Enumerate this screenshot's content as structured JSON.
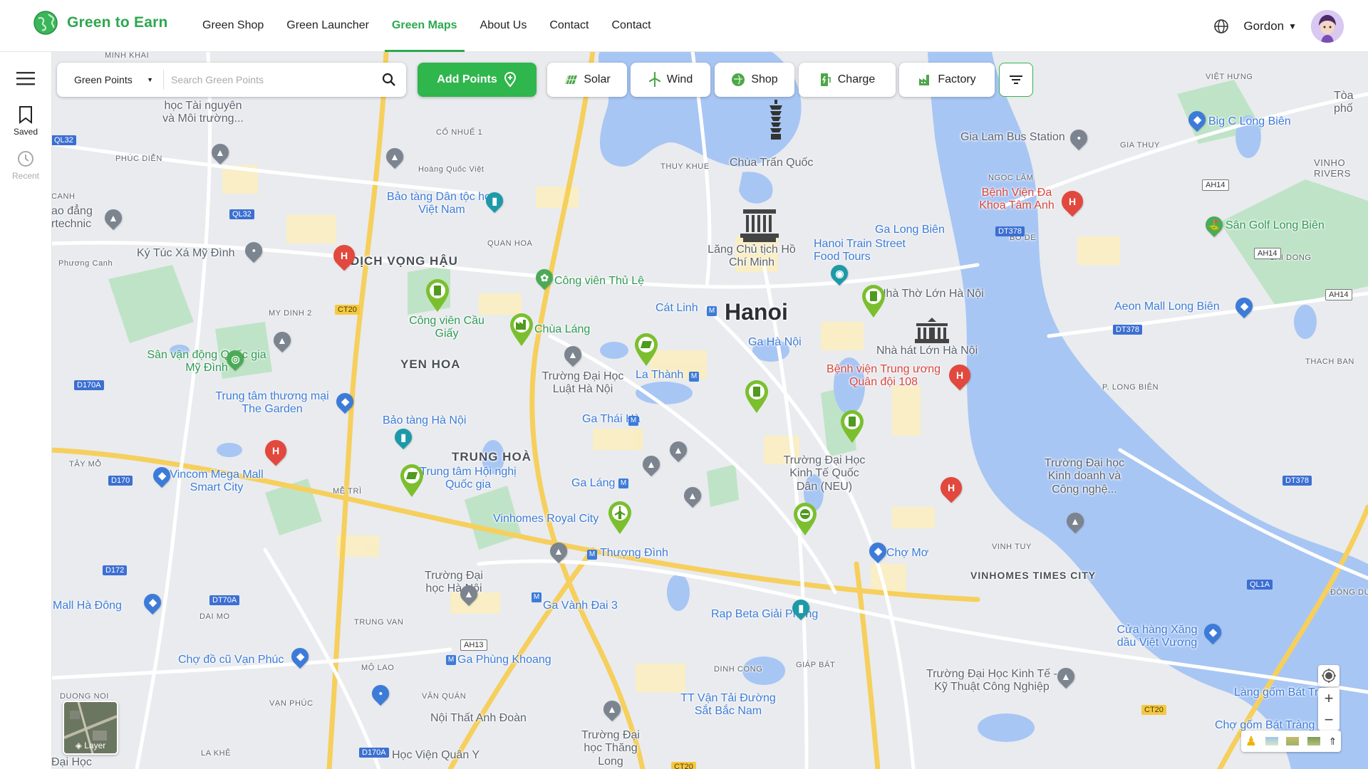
{
  "brand": {
    "name": "Green to Earn",
    "color": "#2da84f"
  },
  "nav": [
    {
      "label": "Green Shop",
      "active": false
    },
    {
      "label": "Green Launcher",
      "active": false
    },
    {
      "label": "Green Maps",
      "active": true
    },
    {
      "label": "About Us",
      "active": false
    },
    {
      "label": "Contact",
      "active": false
    },
    {
      "label": "Contact",
      "active": false
    }
  ],
  "user": {
    "name": "Gordon",
    "icons": [
      "globe-icon",
      "caret-down-icon",
      "avatar"
    ]
  },
  "rail": {
    "menu_icon": "hamburger-icon",
    "saved": "Saved",
    "recent": "Recent"
  },
  "search": {
    "select_value": "Green Points",
    "placeholder": "Search Green Points"
  },
  "toolbar": {
    "add_points": "Add Points",
    "chips": [
      "Solar",
      "Wind",
      "Shop",
      "Charge",
      "Factory"
    ],
    "filter_icon": "filter-icon"
  },
  "map": {
    "city": "Hanoi",
    "districts": [
      "DỊCH VỌNG HẬU",
      "YEN HOA",
      "TRUNG HOÀ",
      "VINHOMES TIMES CITY"
    ],
    "labels": {
      "ky_tuc_xa": "Ký Túc Xá Mỹ Đình",
      "bao_tang_dan_toc": "Bảo tàng Dân tộc học Việt Nam",
      "cong_vien_thu_le": "Công viên Thủ Lệ",
      "cong_vien_cau_giay": "Công viên Cầu Giấy",
      "chua_lang": "Chùa Láng",
      "truong_dai_hoc_luat": "Trường Đại Học Luật Hà Nội",
      "la_thanh": "La Thành",
      "san_van_dong": "Sân vận động Quốc gia Mỹ Đình",
      "trung_tam_thuong_mai": "Trung tâm thương mại The Garden",
      "bao_tang_ha_noi": "Bảo tàng Hà Nội",
      "trung_tam_hoi_nghi": "Trung tâm Hội nghị Quốc gia",
      "vincom_mega": "Vincom Mega Mall Smart City",
      "vinhomes_royal": "Vinhomes Royal City",
      "thuong_dinh": "Thượng Đình",
      "truong_dai_hoc_ha_noi": "Trường Đại học Hà Nội",
      "ga_vanh_dai_3": "Ga Vành Đai 3",
      "ga_phung_khoang": "Ga Phùng Khoang",
      "mall_ha_dong": "Mall Hà Đông",
      "cho_do_cu": "Chợ đồ cũ Vạn Phúc",
      "noi_that": "Nội Thất Anh Đoàn",
      "hoc_vien": "Học Viện Quân Y",
      "truong_thang_long": "Trường Đại học Thăng Long",
      "tt_van_tai": "TT Vận Tải Đường Sắt Bắc Nam",
      "rap_beta": "Rap Beta Giải Phóng",
      "cho_mo": "Chợ Mơ",
      "truong_neu": "Trường Đại Học Kinh Tế Quốc Dân (NEU)",
      "ga_ha_noi": "Ga Hà Nội",
      "cat_linh": "Cát Linh",
      "ga_thai_ha": "Ga Thái Hà",
      "ga_lang": "Ga Láng",
      "lang_chu_tich": "Lăng Chủ tịch Hồ Chí Minh",
      "chua_tran_quoc": "Chùa Trấn Quốc",
      "hanoi_train": "Hanoi Train Street Food Tours",
      "ga_long_bien": "Ga Long Biên",
      "nha_tho_lon": "Nhà Thờ Lớn Hà Nội",
      "nha_hat_lon": "Nhà hát Lớn Hà Nội",
      "benh_vien_108": "Bệnh viện Trung ương Quân đội 108",
      "benh_vien_tam_anh": "Bệnh Viện Đa Khoa Tâm Anh",
      "gia_lam_bus": "Gia Lam Bus Station",
      "big_c": "Big C Long Biên",
      "san_golf": "Sân Golf Long Biên",
      "aeon_mall": "Aeon Mall Long Biên",
      "truong_kinh_doanh": "Trường Đại học Kinh doanh và Công nghệ...",
      "cua_hang_xang": "Cửa hàng Xăng dầu Việt Vương",
      "truong_kinh_te_ky_thuat": "Trường Đại Học Kinh Tế - Kỹ Thuật Công Nghiệp",
      "lang_gom": "Làng gốm Bát Tràng",
      "cho_gom": "Chợ gốm Bát Tràng",
      "vinho_river": "VINHO RIVERS",
      "dai_hoc": "Đại Học",
      "toa_pho": "Tòa phố",
      "hoc_tai": "học Tài nguyên và Môi trường...",
      "ao_dang": "ao đẳng rtechnic",
      "minh_khai": "MINH KHAI",
      "co_nhue": "CỔ NHUẾ 1",
      "phuc_dien": "PHÚC DIỄN",
      "canh": "CANH",
      "hoang_quoc_viet": "Hoàng Quốc Việt",
      "thuy_khue": "THUY KHUE",
      "quan_hoa": "QUAN HOA",
      "my_dinh_2": "MY DINH 2",
      "tay_mo": "TÂY MỖ",
      "me_tri": "MỄ TRÌ",
      "dai_mo": "DAI MO",
      "trung_van": "TRUNG VAN",
      "mo_lao": "MỘ LAO",
      "van_quan": "VĂN QUÁN",
      "van_phuc": "VẠN PHÚC",
      "duong_noi": "DUONG NOI",
      "la_khe": "LA KHÊ",
      "dinh_cong": "DINH CONG",
      "giap_bat": "GIÁP BÁT",
      "vinh_tuy": "VINH TUY",
      "ngoc_lam": "NGỌC LÂM",
      "gia_thuy": "GIA THUY",
      "bo_de": "BO DE",
      "sai_dong": "SAI DONG",
      "thach_ban": "THACH BAN",
      "p_long_bien": "P. LONG BIÊN",
      "dong_du": "ĐÔNG DƯ",
      "viet_hung": "VIỆT HƯNG",
      "phuong_canh": "Phương Canh"
    },
    "shields": [
      "QL32",
      "QL32",
      "CT20",
      "D170A",
      "D170",
      "D172",
      "DT70A",
      "AH13",
      "D170A",
      "AH14",
      "DT378",
      "AH14",
      "AH14",
      "DT378",
      "DT378",
      "QL1A",
      "CT20",
      "CT20"
    ]
  },
  "controls": {
    "layer": "Layer",
    "zoom_in": "+",
    "zoom_out": "−"
  }
}
